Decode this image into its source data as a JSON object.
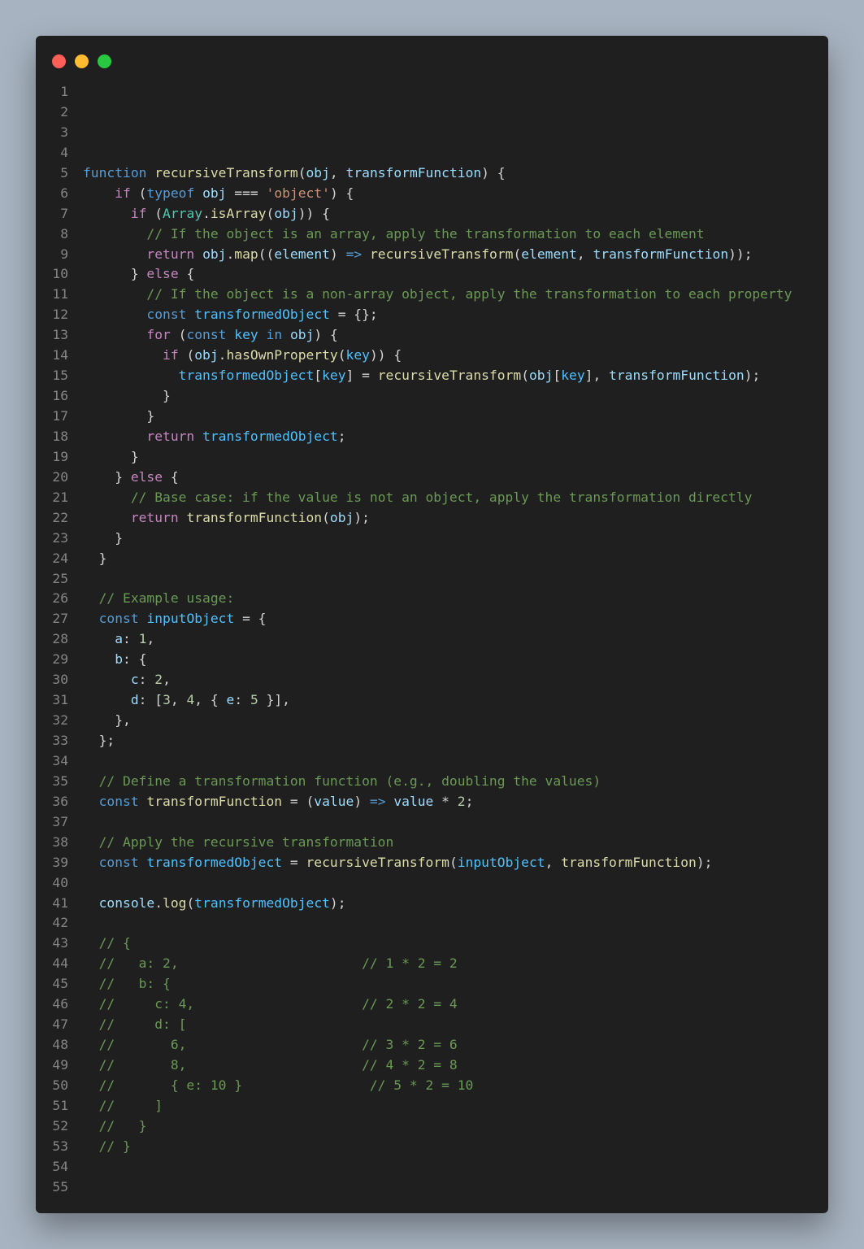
{
  "window": {
    "controls": [
      {
        "name": "close",
        "color": "#ff5f57"
      },
      {
        "name": "minimize",
        "color": "#febc2e"
      },
      {
        "name": "maximize",
        "color": "#28c840"
      }
    ]
  },
  "colors": {
    "keyword": "#569cd6",
    "control": "#c586c0",
    "function": "#dcdcaa",
    "variable": "#9cdcfe",
    "constant": "#4fc1ff",
    "string": "#ce9178",
    "number": "#b5cea8",
    "class": "#4ec9b0",
    "comment": "#6a9955",
    "text": "#d4d4d4",
    "line_number": "#858585",
    "editor_bg": "#1f1f1f",
    "page_bg": "#a7b3c0"
  },
  "code_lines": [
    [],
    [],
    [],
    [],
    [
      [
        "kw",
        "function"
      ],
      [
        "op",
        " "
      ],
      [
        "fn",
        "recursiveTransform"
      ],
      [
        "op",
        "("
      ],
      [
        "var",
        "obj"
      ],
      [
        "op",
        ", "
      ],
      [
        "var",
        "transformFunction"
      ],
      [
        "op",
        ") {"
      ]
    ],
    [
      [
        "op",
        "    "
      ],
      [
        "ctl",
        "if"
      ],
      [
        "op",
        " ("
      ],
      [
        "kw",
        "typeof"
      ],
      [
        "op",
        " "
      ],
      [
        "var",
        "obj"
      ],
      [
        "op",
        " === "
      ],
      [
        "str",
        "'object'"
      ],
      [
        "op",
        ") {"
      ]
    ],
    [
      [
        "op",
        "      "
      ],
      [
        "ctl",
        "if"
      ],
      [
        "op",
        " ("
      ],
      [
        "cls",
        "Array"
      ],
      [
        "op",
        "."
      ],
      [
        "fn",
        "isArray"
      ],
      [
        "op",
        "("
      ],
      [
        "var",
        "obj"
      ],
      [
        "op",
        ")) {"
      ]
    ],
    [
      [
        "op",
        "        "
      ],
      [
        "cm",
        "// If the object is an array, apply the transformation to each element"
      ]
    ],
    [
      [
        "op",
        "        "
      ],
      [
        "ctl",
        "return"
      ],
      [
        "op",
        " "
      ],
      [
        "var",
        "obj"
      ],
      [
        "op",
        "."
      ],
      [
        "fn",
        "map"
      ],
      [
        "op",
        "(("
      ],
      [
        "var",
        "element"
      ],
      [
        "op",
        ") "
      ],
      [
        "kw",
        "=>"
      ],
      [
        "op",
        " "
      ],
      [
        "fn",
        "recursiveTransform"
      ],
      [
        "op",
        "("
      ],
      [
        "var",
        "element"
      ],
      [
        "op",
        ", "
      ],
      [
        "var",
        "transformFunction"
      ],
      [
        "op",
        "));"
      ]
    ],
    [
      [
        "op",
        "      } "
      ],
      [
        "ctl",
        "else"
      ],
      [
        "op",
        " {"
      ]
    ],
    [
      [
        "op",
        "        "
      ],
      [
        "cm",
        "// If the object is a non-array object, apply the transformation to each property"
      ]
    ],
    [
      [
        "op",
        "        "
      ],
      [
        "kw",
        "const"
      ],
      [
        "op",
        " "
      ],
      [
        "cst",
        "transformedObject"
      ],
      [
        "op",
        " = {};"
      ]
    ],
    [
      [
        "op",
        "        "
      ],
      [
        "ctl",
        "for"
      ],
      [
        "op",
        " ("
      ],
      [
        "kw",
        "const"
      ],
      [
        "op",
        " "
      ],
      [
        "cst",
        "key"
      ],
      [
        "op",
        " "
      ],
      [
        "kw",
        "in"
      ],
      [
        "op",
        " "
      ],
      [
        "var",
        "obj"
      ],
      [
        "op",
        ") {"
      ]
    ],
    [
      [
        "op",
        "          "
      ],
      [
        "ctl",
        "if"
      ],
      [
        "op",
        " ("
      ],
      [
        "var",
        "obj"
      ],
      [
        "op",
        "."
      ],
      [
        "fn",
        "hasOwnProperty"
      ],
      [
        "op",
        "("
      ],
      [
        "cst",
        "key"
      ],
      [
        "op",
        ")) {"
      ]
    ],
    [
      [
        "op",
        "            "
      ],
      [
        "cst",
        "transformedObject"
      ],
      [
        "op",
        "["
      ],
      [
        "cst",
        "key"
      ],
      [
        "op",
        "] = "
      ],
      [
        "fn",
        "recursiveTransform"
      ],
      [
        "op",
        "("
      ],
      [
        "var",
        "obj"
      ],
      [
        "op",
        "["
      ],
      [
        "cst",
        "key"
      ],
      [
        "op",
        "], "
      ],
      [
        "var",
        "transformFunction"
      ],
      [
        "op",
        ");"
      ]
    ],
    [
      [
        "op",
        "          }"
      ]
    ],
    [
      [
        "op",
        "        }"
      ]
    ],
    [
      [
        "op",
        "        "
      ],
      [
        "ctl",
        "return"
      ],
      [
        "op",
        " "
      ],
      [
        "cst",
        "transformedObject"
      ],
      [
        "op",
        ";"
      ]
    ],
    [
      [
        "op",
        "      }"
      ]
    ],
    [
      [
        "op",
        "    } "
      ],
      [
        "ctl",
        "else"
      ],
      [
        "op",
        " {"
      ]
    ],
    [
      [
        "op",
        "      "
      ],
      [
        "cm",
        "// Base case: if the value is not an object, apply the transformation directly"
      ]
    ],
    [
      [
        "op",
        "      "
      ],
      [
        "ctl",
        "return"
      ],
      [
        "op",
        " "
      ],
      [
        "fn",
        "transformFunction"
      ],
      [
        "op",
        "("
      ],
      [
        "var",
        "obj"
      ],
      [
        "op",
        ");"
      ]
    ],
    [
      [
        "op",
        "    }"
      ]
    ],
    [
      [
        "op",
        "  }"
      ]
    ],
    [],
    [
      [
        "op",
        "  "
      ],
      [
        "cm",
        "// Example usage:"
      ]
    ],
    [
      [
        "op",
        "  "
      ],
      [
        "kw",
        "const"
      ],
      [
        "op",
        " "
      ],
      [
        "cst",
        "inputObject"
      ],
      [
        "op",
        " = {"
      ]
    ],
    [
      [
        "op",
        "    "
      ],
      [
        "var",
        "a"
      ],
      [
        "op",
        ": "
      ],
      [
        "num",
        "1"
      ],
      [
        "op",
        ","
      ]
    ],
    [
      [
        "op",
        "    "
      ],
      [
        "var",
        "b"
      ],
      [
        "op",
        ": {"
      ]
    ],
    [
      [
        "op",
        "      "
      ],
      [
        "var",
        "c"
      ],
      [
        "op",
        ": "
      ],
      [
        "num",
        "2"
      ],
      [
        "op",
        ","
      ]
    ],
    [
      [
        "op",
        "      "
      ],
      [
        "var",
        "d"
      ],
      [
        "op",
        ": ["
      ],
      [
        "num",
        "3"
      ],
      [
        "op",
        ", "
      ],
      [
        "num",
        "4"
      ],
      [
        "op",
        ", { "
      ],
      [
        "var",
        "e"
      ],
      [
        "op",
        ": "
      ],
      [
        "num",
        "5"
      ],
      [
        "op",
        " }],"
      ]
    ],
    [
      [
        "op",
        "    },"
      ]
    ],
    [
      [
        "op",
        "  };"
      ]
    ],
    [],
    [
      [
        "op",
        "  "
      ],
      [
        "cm",
        "// Define a transformation function (e.g., doubling the values)"
      ]
    ],
    [
      [
        "op",
        "  "
      ],
      [
        "kw",
        "const"
      ],
      [
        "op",
        " "
      ],
      [
        "fn",
        "transformFunction"
      ],
      [
        "op",
        " = ("
      ],
      [
        "var",
        "value"
      ],
      [
        "op",
        ") "
      ],
      [
        "kw",
        "=>"
      ],
      [
        "op",
        " "
      ],
      [
        "var",
        "value"
      ],
      [
        "op",
        " * "
      ],
      [
        "num",
        "2"
      ],
      [
        "op",
        ";"
      ]
    ],
    [],
    [
      [
        "op",
        "  "
      ],
      [
        "cm",
        "// Apply the recursive transformation"
      ]
    ],
    [
      [
        "op",
        "  "
      ],
      [
        "kw",
        "const"
      ],
      [
        "op",
        " "
      ],
      [
        "cst",
        "transformedObject"
      ],
      [
        "op",
        " = "
      ],
      [
        "fn",
        "recursiveTransform"
      ],
      [
        "op",
        "("
      ],
      [
        "cst",
        "inputObject"
      ],
      [
        "op",
        ", "
      ],
      [
        "fn",
        "transformFunction"
      ],
      [
        "op",
        ");"
      ]
    ],
    [],
    [
      [
        "op",
        "  "
      ],
      [
        "var",
        "console"
      ],
      [
        "op",
        "."
      ],
      [
        "fn",
        "log"
      ],
      [
        "op",
        "("
      ],
      [
        "cst",
        "transformedObject"
      ],
      [
        "op",
        ");"
      ]
    ],
    [],
    [
      [
        "op",
        "  "
      ],
      [
        "cm",
        "// {"
      ]
    ],
    [
      [
        "op",
        "  "
      ],
      [
        "cm",
        "//   a: 2,                       // 1 * 2 = 2"
      ]
    ],
    [
      [
        "op",
        "  "
      ],
      [
        "cm",
        "//   b: {"
      ]
    ],
    [
      [
        "op",
        "  "
      ],
      [
        "cm",
        "//     c: 4,                     // 2 * 2 = 4"
      ]
    ],
    [
      [
        "op",
        "  "
      ],
      [
        "cm",
        "//     d: ["
      ]
    ],
    [
      [
        "op",
        "  "
      ],
      [
        "cm",
        "//       6,                      // 3 * 2 = 6"
      ]
    ],
    [
      [
        "op",
        "  "
      ],
      [
        "cm",
        "//       8,                      // 4 * 2 = 8"
      ]
    ],
    [
      [
        "op",
        "  "
      ],
      [
        "cm",
        "//       { e: 10 }                // 5 * 2 = 10"
      ]
    ],
    [
      [
        "op",
        "  "
      ],
      [
        "cm",
        "//     ]"
      ]
    ],
    [
      [
        "op",
        "  "
      ],
      [
        "cm",
        "//   }"
      ]
    ],
    [
      [
        "op",
        "  "
      ],
      [
        "cm",
        "// }"
      ]
    ],
    [],
    []
  ]
}
